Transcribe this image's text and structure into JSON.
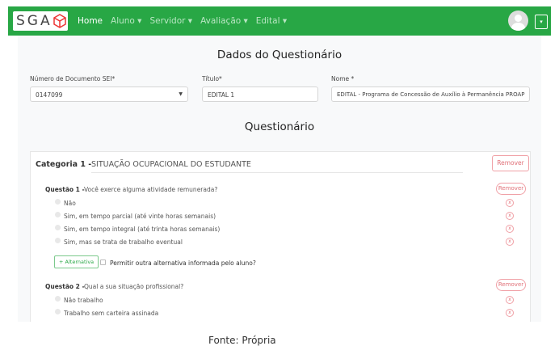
{
  "navbar": {
    "logo": "SGA",
    "items": [
      {
        "label": "Home"
      },
      {
        "label": "Aluno ▾"
      },
      {
        "label": "Servidor ▾"
      },
      {
        "label": "Avaliação ▾"
      },
      {
        "label": "Edital ▾"
      }
    ],
    "menu_toggle": "▾",
    "color": "#28a745"
  },
  "form": {
    "title": "Dados do Questionário",
    "sei_label": "Número de Documento SEI*",
    "sei_value": "0147099",
    "titulo_label": "Título*",
    "titulo_value": "EDITAL 1",
    "nome_label": "Nome *",
    "nome_value": "EDITAL - Programa de Concessão de Auxílio à Permanência PROAP"
  },
  "questionario": {
    "title": "Questionário",
    "categoria": {
      "label": "Categoria 1 -",
      "value": "SITUAÇÃO OCUPACIONAL DO ESTUDANTE",
      "remove": "Remover"
    },
    "questions": [
      {
        "label": "Questão 1 -",
        "text": "Você exerce alguma atividade remunerada?",
        "remove": "Remover",
        "options": [
          "Não",
          "Sim, em tempo parcial (até vinte horas semanais)",
          "Sim, em tempo integral (até trinta horas semanais)",
          "Sim, mas se trata de trabalho eventual"
        ],
        "add_alt": "+ Alternativa",
        "allow_other": "Permitir outra alternativa informada pelo aluno?"
      },
      {
        "label": "Questão 2 -",
        "text": "Qual a sua situação profissional?",
        "remove": "Remover",
        "options": [
          "Não trabalho",
          "Trabalho sem carteira assinada"
        ]
      }
    ]
  },
  "caption": "Fonte: Própria"
}
